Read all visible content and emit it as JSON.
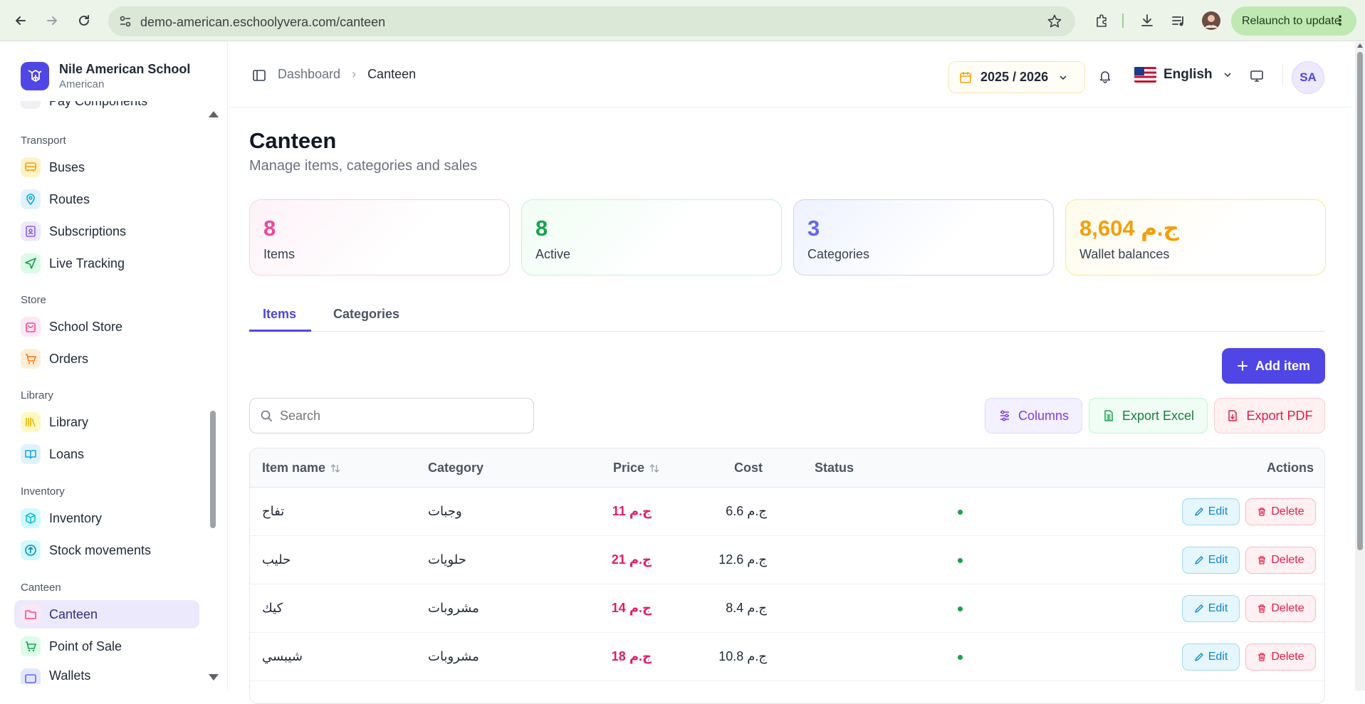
{
  "browser": {
    "url": "demo-american.eschoolyvera.com/canteen",
    "relaunch_label": "Relaunch to update"
  },
  "sidebar": {
    "school_name": "Nile American School",
    "school_type": "American",
    "partial_item": "Pay Components",
    "sections": {
      "transport": "Transport",
      "store": "Store",
      "library": "Library",
      "inventory": "Inventory",
      "canteen": "Canteen"
    },
    "items": {
      "buses": "Buses",
      "routes": "Routes",
      "subscriptions": "Subscriptions",
      "live_tracking": "Live Tracking",
      "school_store": "School Store",
      "orders": "Orders",
      "library": "Library",
      "loans": "Loans",
      "inventory": "Inventory",
      "stock_movements": "Stock movements",
      "canteen": "Canteen",
      "point_of_sale": "Point of Sale",
      "wallets": "Wallets"
    }
  },
  "header": {
    "breadcrumb_home": "Dashboard",
    "breadcrumb_current": "Canteen",
    "academic_year": "2025 / 2026",
    "language": "English",
    "avatar_initials": "SA"
  },
  "page": {
    "title": "Canteen",
    "subtitle": "Manage items, categories and sales"
  },
  "stats": {
    "items": {
      "value": "8",
      "label": "Items"
    },
    "active": {
      "value": "8",
      "label": "Active"
    },
    "categories": {
      "value": "3",
      "label": "Categories"
    },
    "wallet": {
      "value": "8,604 ج.م",
      "label": "Wallet balances"
    }
  },
  "tabs": {
    "items": "Items",
    "categories": "Categories"
  },
  "toolbar": {
    "add_item": "Add item",
    "search_placeholder": "Search",
    "columns": "Columns",
    "export_excel": "Export Excel",
    "export_pdf": "Export PDF"
  },
  "table": {
    "headers": {
      "item_name": "Item name",
      "category": "Category",
      "price": "Price",
      "cost": "Cost",
      "status": "Status",
      "actions": "Actions"
    },
    "edit_label": "Edit",
    "delete_label": "Delete",
    "rows": [
      {
        "name": "تفاح",
        "category": "وجبات",
        "price": "11 ج.م",
        "cost": "6.6 ج.م"
      },
      {
        "name": "حليب",
        "category": "حلويات",
        "price": "21 ج.م",
        "cost": "12.6 ج.م"
      },
      {
        "name": "كيك",
        "category": "مشروبات",
        "price": "14 ج.م",
        "cost": "8.4 ج.م"
      },
      {
        "name": "شيبسي",
        "category": "مشروبات",
        "price": "18 ج.م",
        "cost": "10.8 ج.م"
      }
    ]
  },
  "colors": {
    "accent": "#4f46e5",
    "items_stat": "#ec4899",
    "active_stat": "#16a34a",
    "categories_stat": "#6366f1",
    "wallet_stat": "#f59e0b",
    "price": "#e11d6b",
    "status_active": "#16a34a"
  },
  "icons": [
    "back-icon",
    "forward-icon",
    "reload-icon",
    "site-info-icon",
    "star-icon",
    "extensions-icon",
    "download-icon",
    "media-icon",
    "profile-icon",
    "menu-dots-icon",
    "school-logo-icon",
    "bus-icon",
    "map-pin-icon",
    "id-card-icon",
    "send-icon",
    "bag-icon",
    "cart-icon",
    "books-icon",
    "book-open-icon",
    "box-icon",
    "arrow-up-circle-icon",
    "folder-icon",
    "pos-cart-icon",
    "wallet-icon",
    "sidebar-toggle-icon",
    "calendar-icon",
    "bell-icon",
    "us-flag-icon",
    "monitor-icon",
    "plus-icon",
    "search-icon",
    "sliders-icon",
    "excel-icon",
    "pdf-icon",
    "sort-icon",
    "edit-icon",
    "trash-icon"
  ]
}
